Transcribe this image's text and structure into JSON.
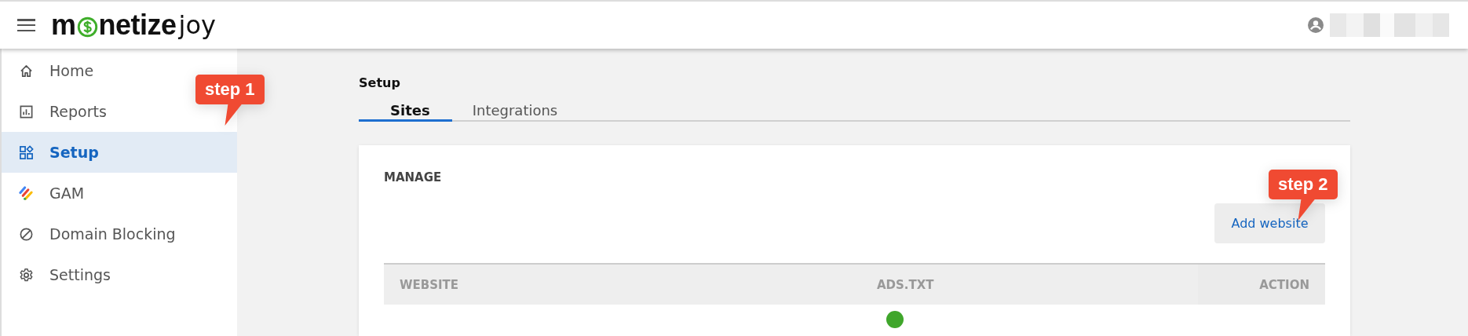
{
  "header": {
    "logo": {
      "lead": "m",
      "middle": "netize",
      "tail": "joy"
    }
  },
  "sidebar": {
    "items": [
      {
        "label": "Home",
        "selected": false
      },
      {
        "label": "Reports",
        "selected": false
      },
      {
        "label": "Setup",
        "selected": true
      },
      {
        "label": "GAM",
        "selected": false
      },
      {
        "label": "Domain Blocking",
        "selected": false
      },
      {
        "label": "Settings",
        "selected": false
      }
    ]
  },
  "page": {
    "title": "Setup",
    "tabs": [
      {
        "label": "Sites",
        "selected": true
      },
      {
        "label": "Integrations",
        "selected": false
      }
    ],
    "card": {
      "heading": "MANAGE",
      "button": "Add website",
      "table": {
        "columns": [
          "WEBSITE",
          "ADS.TXT",
          "ACTION"
        ],
        "rows": [
          {
            "kind": "verified"
          }
        ]
      }
    }
  },
  "callouts": [
    {
      "label": "step 1"
    },
    {
      "label": "step 2"
    }
  ]
}
